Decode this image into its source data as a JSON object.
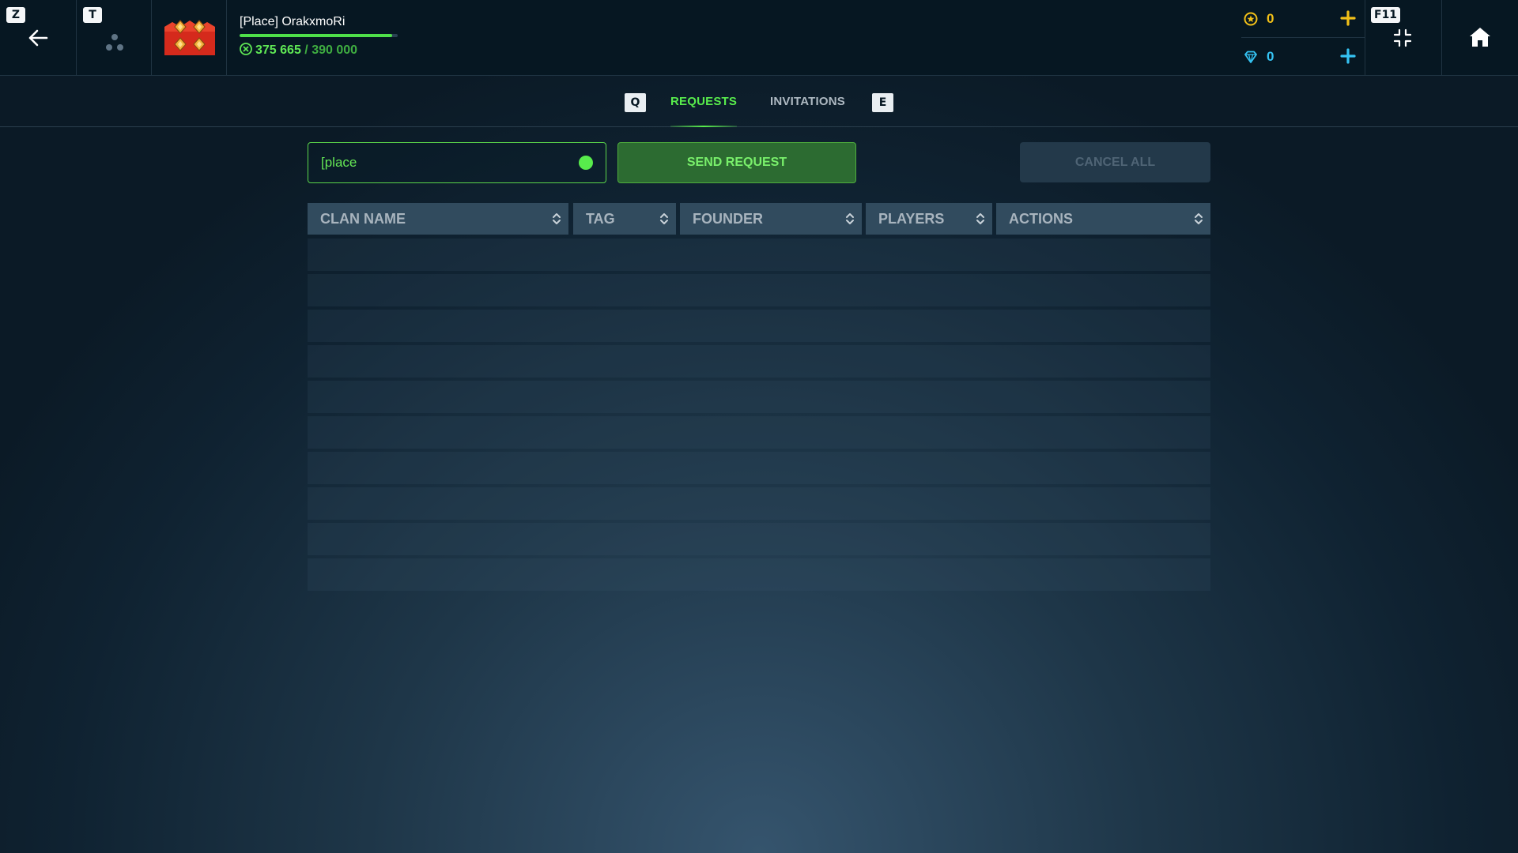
{
  "topbar": {
    "back_key": "Z",
    "team_key": "T",
    "player": {
      "name": "[Place] OrakxmoRi",
      "xp_current": "375 665",
      "xp_separator": "/",
      "xp_total": "390 000",
      "xp_progress": 0.9633
    },
    "currency": {
      "gold_value": "0",
      "gem_value": "0"
    },
    "fullscreen_key": "F11"
  },
  "tabs": {
    "prev_key": "Q",
    "next_key": "E",
    "items": [
      {
        "label": "REQUESTS",
        "active": true
      },
      {
        "label": "INVITATIONS",
        "active": false
      }
    ]
  },
  "controls": {
    "search_value": "[place",
    "send_label": "SEND REQUEST",
    "cancel_label": "CANCEL ALL"
  },
  "table": {
    "columns": [
      "CLAN NAME",
      "TAG",
      "FOUNDER",
      "PLAYERS",
      "ACTIONS"
    ],
    "rows": []
  },
  "colors": {
    "accent_green": "#58ec4c",
    "gold": "#f2c018",
    "gem": "#35c3f3",
    "topbar_bg": "#061722"
  }
}
